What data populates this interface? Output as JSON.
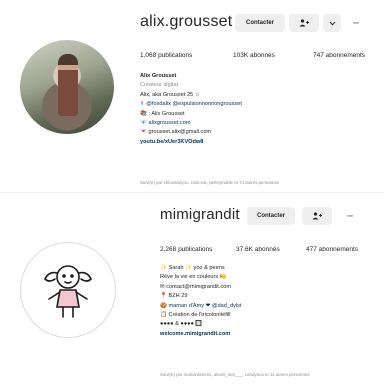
{
  "profile1": {
    "username": "alix.grousset",
    "follow_label": "Contacter",
    "more_label": "⋯",
    "stats": {
      "posts": "1,068 publications",
      "followers": "103K abonnés",
      "following": "747 abonnements"
    },
    "bio": {
      "name": "Alix Grousset",
      "category": "Créateur digital",
      "line1": "Alix, aka Grousset 25 ☆",
      "line2": "✌ @foxdalix @expulsionnonnongrousset",
      "line3": "📚 : Alix Grousset",
      "line4": "📧 alixgrousset.com",
      "line5": "💌 grousset.alix@gmail.com",
      "link": "youtu.be/xUer3KVOdw8"
    },
    "followed_by": "Suivi(e) par chloeandyou, rock.eat, perleymable et 74 autres personnes"
  },
  "profile2": {
    "username": "mimigrandit",
    "follow_label": "Contacter",
    "more_label": "⋯",
    "stats": {
      "posts": "2,268 publications",
      "followers": "37.6K abonnés",
      "following": "477 abonnements"
    },
    "bio": {
      "line1": "✨ Sarah ✨ yoo & peens",
      "line2": "Rêve la vie en couleurs 🍋",
      "line3": "✉ contact@mimigrandit.com",
      "line4": "📍 BZH 29",
      "line5": "🍪 maman d'Amy ❤ @dad_dylst",
      "line6": "📋 Création de l'tricolonitéfill",
      "line7": "●●●● & ●●●● 🔲",
      "link": "welcome.mimigrandit.com"
    },
    "followed_by": "Suivi(e) par maisonlosieris, alexis_mar___, candyoca et 11 autres personnes"
  }
}
